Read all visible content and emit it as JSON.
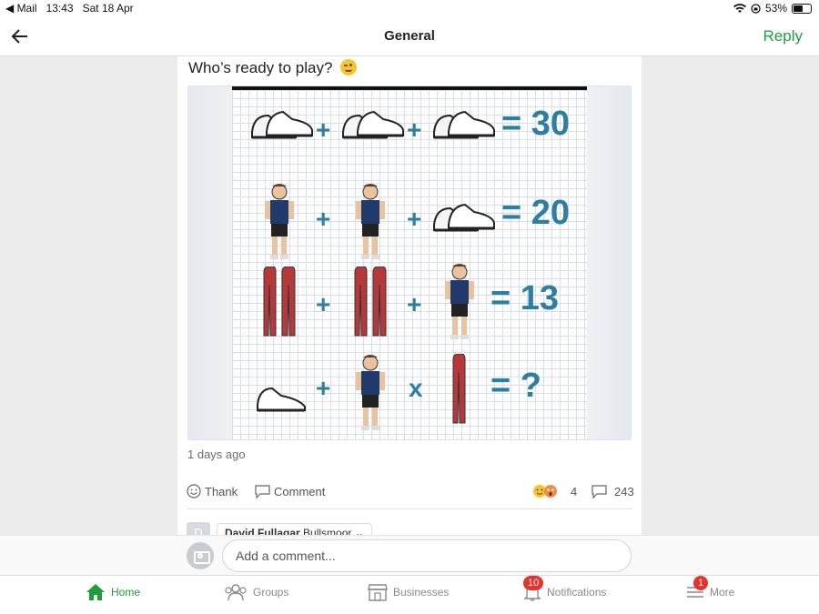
{
  "status_bar": {
    "back_app": "◀ Mail",
    "time": "13:43",
    "date": "Sat 18 Apr",
    "battery": "53%",
    "battery_level": 0.53
  },
  "nav": {
    "title": "General",
    "reply_label": "Reply",
    "accent": "#1f9d3a"
  },
  "post": {
    "text": "Who’s ready to play?",
    "emoji": "winking-face",
    "puzzle": {
      "rows": [
        {
          "equals": "= 30"
        },
        {
          "equals": "= 20"
        },
        {
          "equals": "= 13"
        },
        {
          "equals": "= ?"
        }
      ],
      "operators": [
        "+",
        "+",
        "+",
        "+",
        "+",
        "+",
        "+",
        "x"
      ]
    },
    "time_ago": "1 days ago",
    "actions": {
      "thank": "Thank",
      "comment": "Comment",
      "reactions_count": "4",
      "comments_count": "243"
    },
    "reply_preview": {
      "avatar_letter": "D",
      "name": "David Fullagar",
      "location": "Bullsmoor"
    }
  },
  "comment_bar": {
    "placeholder": "Add a comment..."
  },
  "tabs": [
    {
      "label": "Home",
      "icon": "home-icon",
      "active": true
    },
    {
      "label": "Groups",
      "icon": "groups-icon"
    },
    {
      "label": "Businesses",
      "icon": "store-icon"
    },
    {
      "label": "Notifications",
      "icon": "bell-icon",
      "badge": "10"
    },
    {
      "label": "More",
      "icon": "menu-icon",
      "badge": "1"
    }
  ]
}
